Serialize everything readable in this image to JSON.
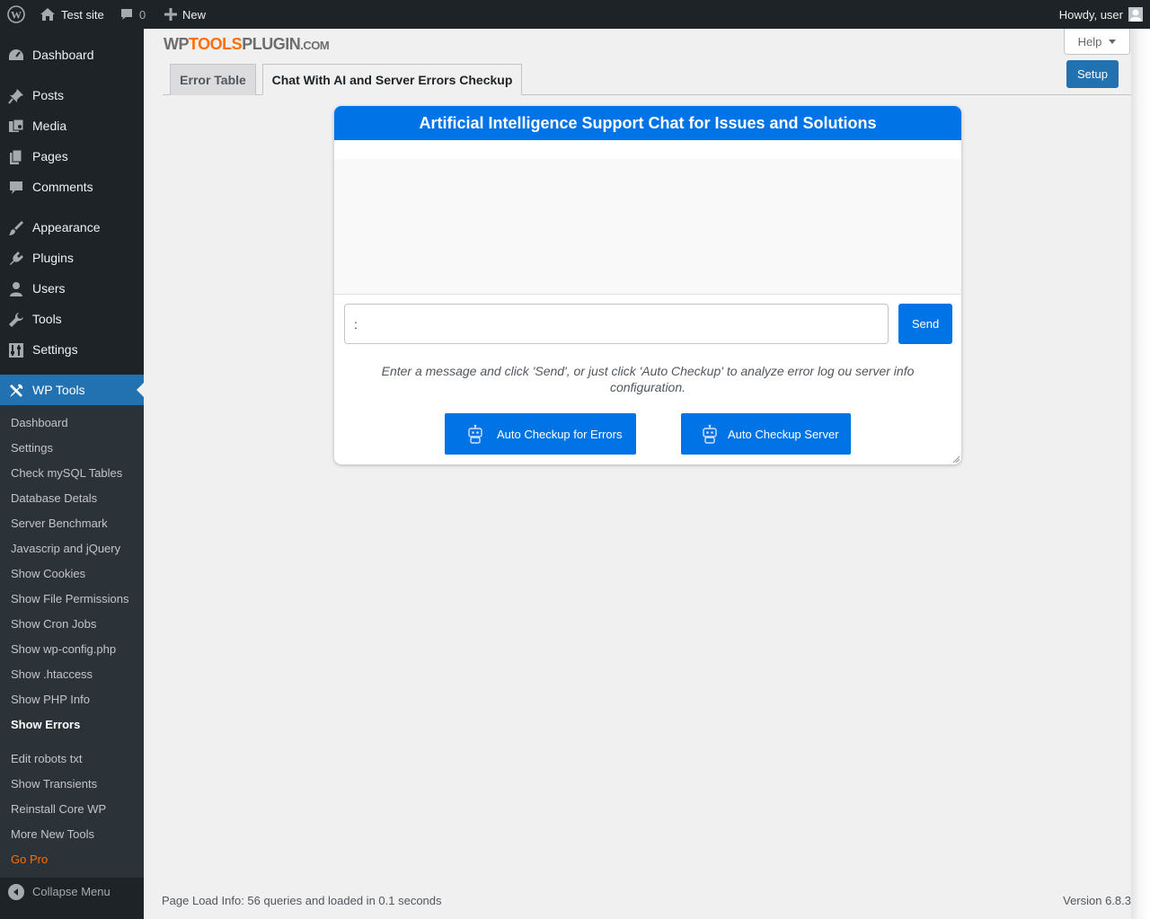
{
  "adminbar": {
    "site_name": "Test site",
    "comments_count": "0",
    "new_label": "New",
    "howdy": "Howdy, user"
  },
  "menu": {
    "items": [
      {
        "label": "Dashboard",
        "icon": "dashboard-icon"
      },
      {
        "label": "Posts",
        "icon": "pin-icon"
      },
      {
        "label": "Media",
        "icon": "media-icon"
      },
      {
        "label": "Pages",
        "icon": "pages-icon"
      },
      {
        "label": "Comments",
        "icon": "comment-icon"
      },
      {
        "label": "Appearance",
        "icon": "brush-icon"
      },
      {
        "label": "Plugins",
        "icon": "plugin-icon"
      },
      {
        "label": "Users",
        "icon": "user-icon"
      },
      {
        "label": "Tools",
        "icon": "wrench-icon"
      },
      {
        "label": "Settings",
        "icon": "sliders-icon"
      },
      {
        "label": "WP Tools",
        "icon": "tools-icon"
      }
    ],
    "submenu": [
      "Dashboard",
      "Settings",
      "Check mySQL Tables",
      "Database Detals",
      "Server Benchmark",
      "Javascrip and jQuery",
      "Show Cookies",
      "Show File Permissions",
      "Show Cron Jobs",
      "Show wp-config.php",
      "Show .htaccess",
      "Show PHP Info",
      "Show Errors",
      "Edit robots txt",
      "Show Transients",
      "Reinstall Core WP",
      "More New Tools",
      "Go Pro"
    ],
    "collapse_label": "Collapse Menu"
  },
  "logo": {
    "part1": "WP",
    "part2": "TOOLS",
    "part3": "PLUGIN",
    "part4": ".COM"
  },
  "help_label": "Help",
  "setup_label": "Setup",
  "tabs": [
    {
      "label": "Error Table"
    },
    {
      "label": "Chat With AI and Server Errors Checkup"
    }
  ],
  "chat": {
    "title": "Artificial Intelligence Support Chat for Issues and Solutions",
    "input_value": ":",
    "send_label": "Send",
    "instructions": "Enter a message and click 'Send', or just click 'Auto Checkup' to analyze error log ou server info configuration.",
    "auto_errors_label": "Auto Checkup for Errors",
    "auto_server_label": "Auto Checkup Server"
  },
  "colors": {
    "accent": "#0073e6",
    "wp_blue": "#2271b1",
    "gopro": "#ff6f00",
    "adminbar": "#1d2327"
  },
  "footer": {
    "load_info": "Page Load Info: 56 queries and loaded in 0.1 seconds",
    "version": "Version 6.8.3"
  }
}
